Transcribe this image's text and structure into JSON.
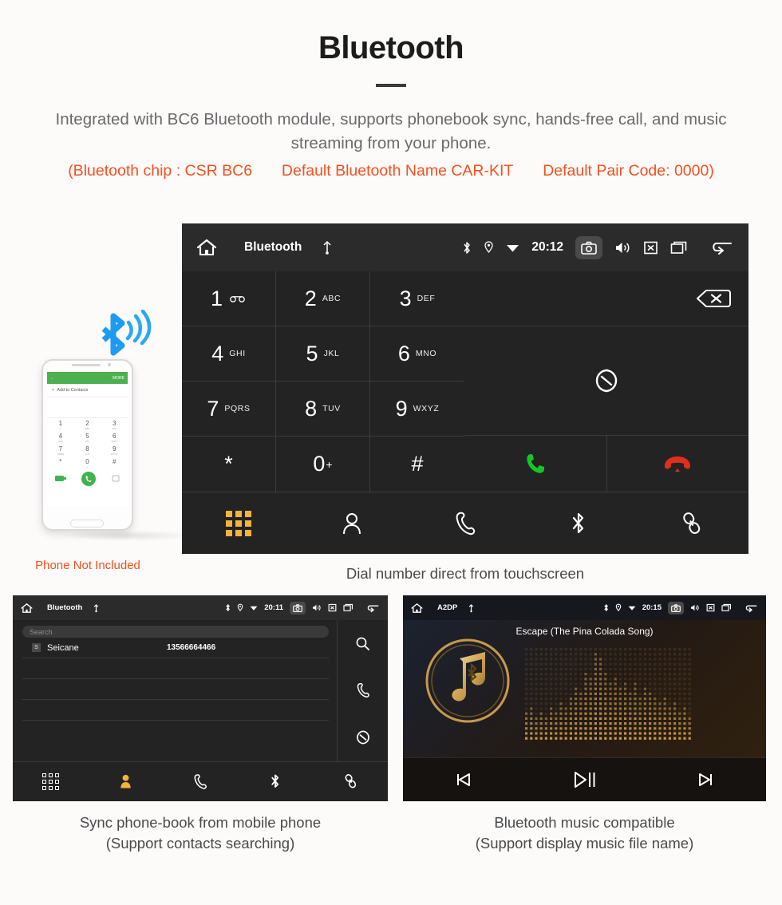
{
  "header": {
    "title": "Bluetooth",
    "subtitle": "Integrated with BC6 Bluetooth module, supports phonebook sync, hands-free call, and music streaming from your phone.",
    "spec_open": "(Bluetooth chip : CSR BC6",
    "spec_name": "Default Bluetooth Name CAR-KIT",
    "spec_pair": "Default Pair Code: 0000)"
  },
  "dialer": {
    "status": {
      "home_icon": "home-icon",
      "title": "Bluetooth",
      "usb_icon": "usb-icon",
      "bluetooth_icon": "bluetooth-icon",
      "location_icon": "location-icon",
      "wifi_icon": "wifi-icon",
      "clock": "20:12",
      "camera_icon": "camera-icon",
      "volume_icon": "volume-icon",
      "close_icon": "close-box-icon",
      "recents_icon": "recents-icon",
      "back_icon": "back-icon"
    },
    "keys": [
      {
        "digit": "1",
        "sub": "",
        "icon": "voicemail-icon"
      },
      {
        "digit": "2",
        "sub": "ABC",
        "icon": ""
      },
      {
        "digit": "3",
        "sub": "DEF",
        "icon": ""
      },
      {
        "digit": "4",
        "sub": "GHI",
        "icon": ""
      },
      {
        "digit": "5",
        "sub": "JKL",
        "icon": ""
      },
      {
        "digit": "6",
        "sub": "MNO",
        "icon": ""
      },
      {
        "digit": "7",
        "sub": "PQRS",
        "icon": ""
      },
      {
        "digit": "8",
        "sub": "TUV",
        "icon": ""
      },
      {
        "digit": "9",
        "sub": "WXYZ",
        "icon": ""
      },
      {
        "digit": "*",
        "sub": "",
        "icon": ""
      },
      {
        "digit": "0",
        "sub": "",
        "icon": "plus-superscript"
      },
      {
        "digit": "#",
        "sub": "",
        "icon": ""
      }
    ],
    "number_field_value": "",
    "backspace_icon": "backspace-icon",
    "sync_icon": "sync-icon",
    "call_icon": "call-icon",
    "hangup_icon": "hangup-icon",
    "accent_green": "#13c723",
    "accent_red": "#e02f1a",
    "nav": [
      {
        "name": "keypad",
        "icon": "keypad-grid-icon",
        "active": true
      },
      {
        "name": "contacts",
        "icon": "person-icon",
        "active": false
      },
      {
        "name": "call-history",
        "icon": "handset-icon",
        "active": false
      },
      {
        "name": "bluetooth",
        "icon": "bluetooth-icon",
        "active": false
      },
      {
        "name": "pair-link",
        "icon": "link-icon",
        "active": false
      }
    ],
    "caption": "Dial number direct from touchscreen"
  },
  "phone_mock": {
    "appbar_back_icon": "back-arrow-icon",
    "appbar_more": "MORE",
    "add_to_contacts": "Add to Contacts",
    "keys": [
      {
        "digit": "1",
        "sub": "∞"
      },
      {
        "digit": "2",
        "sub": "ABC"
      },
      {
        "digit": "3",
        "sub": "DEF"
      },
      {
        "digit": "4",
        "sub": "GHI"
      },
      {
        "digit": "5",
        "sub": "JKL"
      },
      {
        "digit": "6",
        "sub": "MNO"
      },
      {
        "digit": "7",
        "sub": "PQRS"
      },
      {
        "digit": "8",
        "sub": "TUV"
      },
      {
        "digit": "9",
        "sub": "WXYZ"
      },
      {
        "digit": "*",
        "sub": ""
      },
      {
        "digit": "0",
        "sub": "+"
      },
      {
        "digit": "#",
        "sub": ""
      }
    ],
    "not_included_label": "Phone Not Included",
    "not_included_color": "#f4501e",
    "bluetooth_wave_icon": "bluetooth-signal-icon"
  },
  "phonebook": {
    "status": {
      "title": "Bluetooth",
      "clock": "20:11"
    },
    "search_placeholder": "Search",
    "columns": [
      "name",
      "number"
    ],
    "contacts": [
      {
        "initial": "S",
        "name": "Seicane",
        "number": "13566664466"
      }
    ],
    "empty_rows": 4,
    "rail": [
      {
        "name": "search",
        "icon": "search-icon"
      },
      {
        "name": "dial",
        "icon": "handset-icon"
      },
      {
        "name": "sync",
        "icon": "sync-icon"
      }
    ],
    "nav": [
      {
        "name": "keypad",
        "icon": "keypad-grid-icon",
        "active": false
      },
      {
        "name": "contacts",
        "icon": "person-filled-icon",
        "active": true
      },
      {
        "name": "call-history",
        "icon": "handset-icon",
        "active": false
      },
      {
        "name": "bluetooth",
        "icon": "bluetooth-icon",
        "active": false
      },
      {
        "name": "pair-link",
        "icon": "link-icon",
        "active": false
      }
    ],
    "caption_line1": "Sync phone-book from mobile phone",
    "caption_line2": "(Support contacts searching)"
  },
  "music": {
    "status": {
      "title": "A2DP",
      "clock": "20:15"
    },
    "track_title": "Escape (The Pina Colada Song)",
    "album_art_icon": "music-note-bluetooth-icon",
    "equalizer_icon": "dot-matrix-equalizer",
    "accent_gold": "#d1a24a",
    "controls": [
      {
        "name": "previous",
        "icon": "previous-track-icon"
      },
      {
        "name": "play-pause",
        "icon": "play-pause-icon"
      },
      {
        "name": "next",
        "icon": "next-track-icon"
      }
    ],
    "caption_line1": "Bluetooth music compatible",
    "caption_line2": "(Support display music file name)"
  }
}
